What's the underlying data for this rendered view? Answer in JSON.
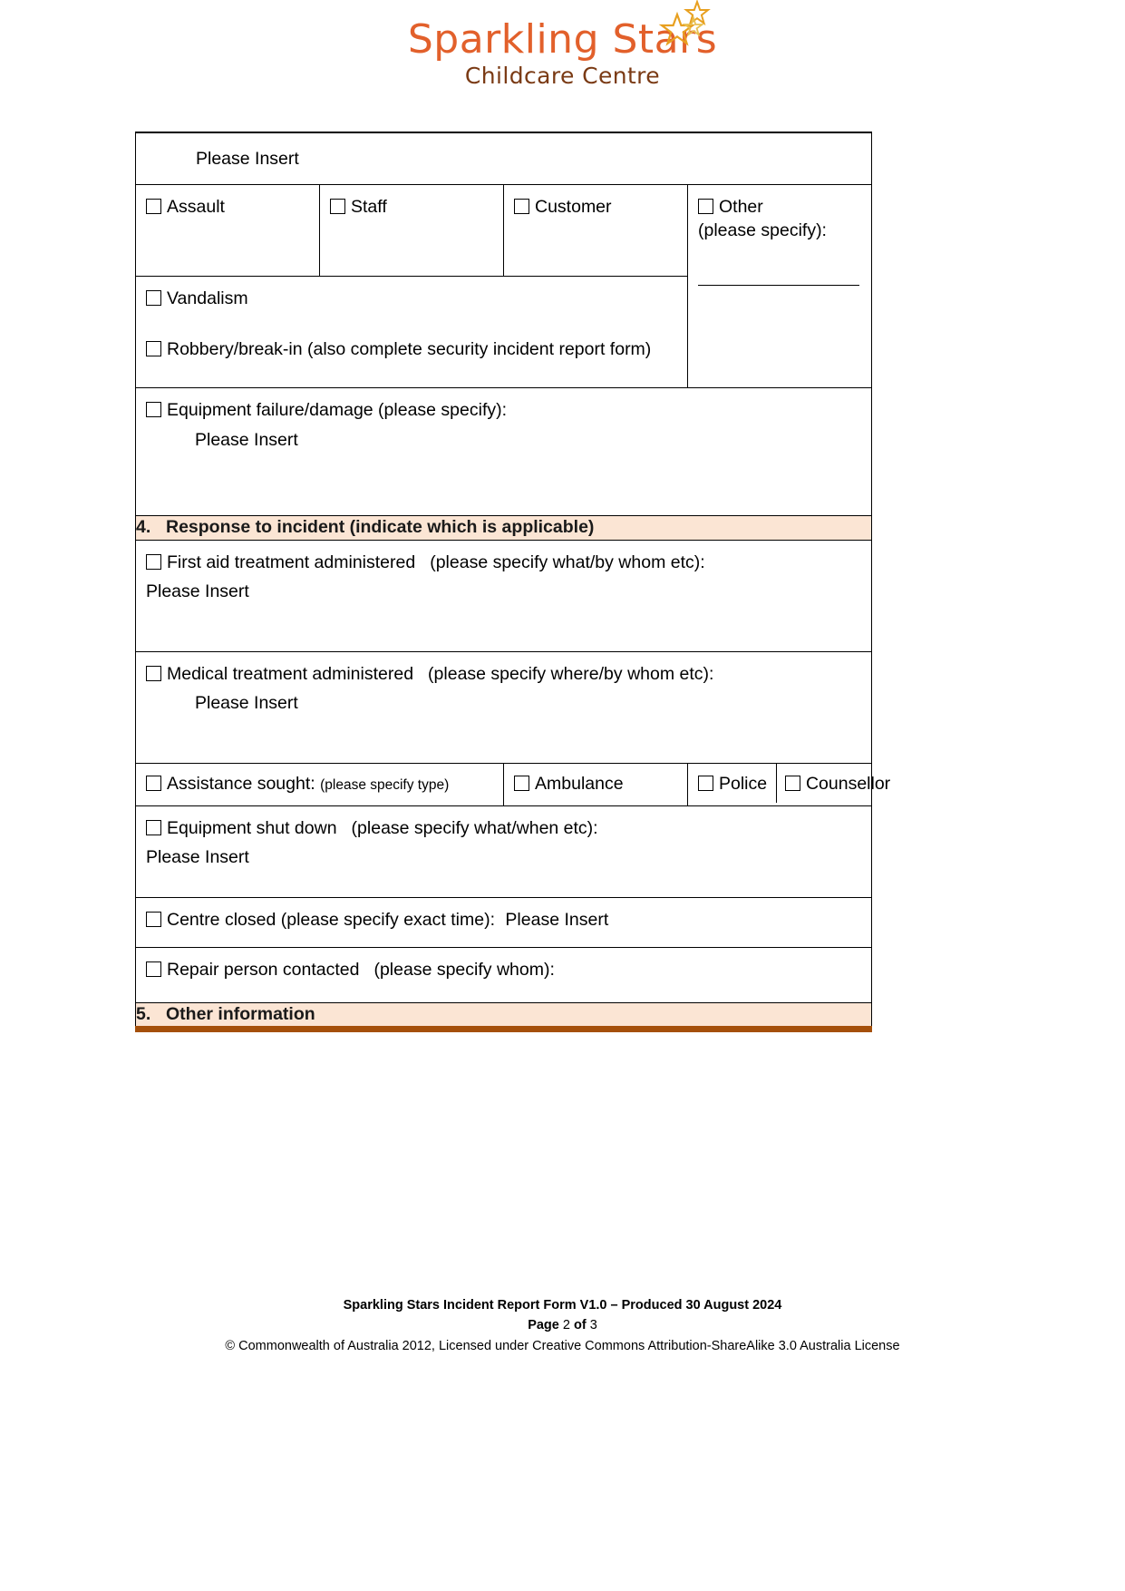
{
  "logo": {
    "name": "Sparkling Stars",
    "subtitle": "Childcare Centre",
    "name_color": "#E2602B",
    "subtitle_color": "#7A3A14",
    "star_color": "#E8A020"
  },
  "form": {
    "top_value": "Please Insert",
    "incident_type_row": [
      {
        "label": "Assault"
      },
      {
        "label": "Staff"
      },
      {
        "label": "Customer"
      },
      {
        "label": "Other",
        "note": "(please specify):"
      }
    ],
    "vandalism": "Vandalism",
    "robbery": "Robbery/break-in (also complete security incident report form)",
    "equipment_failure": {
      "label": "Equipment failure/damage (please specify):",
      "value": "Please Insert"
    },
    "section4": {
      "number": "4.",
      "title": "Response to incident (indicate which is applicable)"
    },
    "first_aid": {
      "label": "First aid treatment administered",
      "note": "(please specify what/by whom etc):",
      "value": "Please Insert"
    },
    "medical": {
      "label": "Medical treatment administered",
      "note": "(please specify where/by whom etc):",
      "value": "Please Insert"
    },
    "assistance": {
      "label": "Assistance sought:",
      "note": "(please specify type)",
      "options": [
        {
          "label": "Ambulance"
        },
        {
          "label": "Police"
        },
        {
          "label": "Counsellor"
        }
      ]
    },
    "equipment_shutdown": {
      "label": "Equipment shut down",
      "note": "(please specify what/when etc):",
      "value": "Please Insert"
    },
    "centre_closed": {
      "label": "Centre closed (please specify exact time):",
      "value": "Please Insert"
    },
    "repair_person": {
      "label": "Repair person contacted",
      "note": "(please specify whom):"
    },
    "section5": {
      "number": "5.",
      "title": "Other information"
    },
    "header_bg": "#FBE5D4",
    "header_rule": "#A5500A"
  },
  "footer": {
    "line1": "Sparkling Stars Incident Report Form V1.0 – Produced 30 August 2024",
    "page_prefix": "Page",
    "page_number": "2",
    "page_of": "of",
    "page_total": "3",
    "line3": "© Commonwealth of Australia 2012, Licensed under Creative Commons Attribution-ShareAlike 3.0 Australia License"
  }
}
